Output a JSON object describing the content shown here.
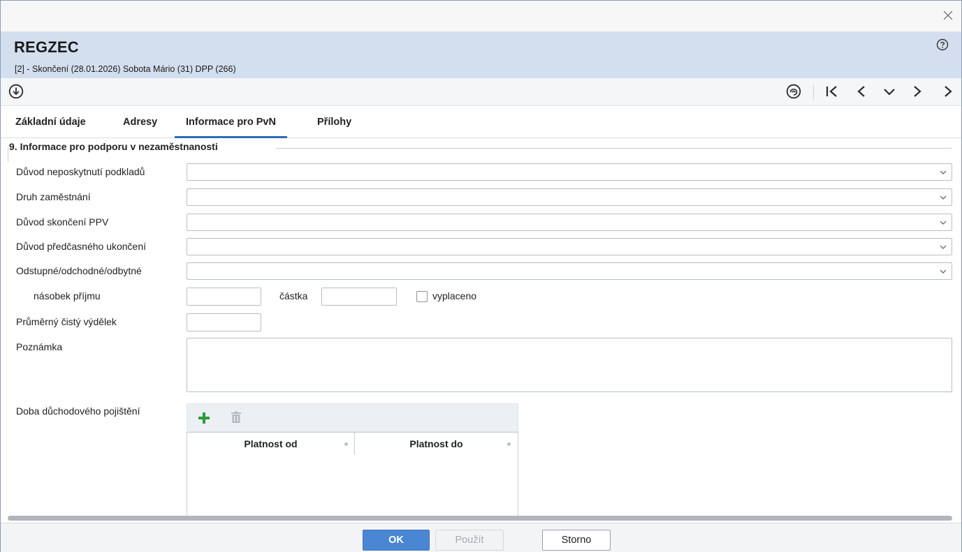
{
  "window": {
    "close_label": "×"
  },
  "header": {
    "title": "REGZEC",
    "subtitle": "[2] - Skončení (28.01.2026) Sobota Mário (31) DPP (266)"
  },
  "toolbar": {
    "icons": [
      "download-circle-icon",
      "fingerprint-icon",
      "first-record-icon",
      "previous-record-icon",
      "dropdown-record-icon",
      "next-record-icon",
      "last-record-icon"
    ]
  },
  "tabs": [
    {
      "label": "Základní údaje",
      "active": false
    },
    {
      "label": "Adresy",
      "active": false
    },
    {
      "label": "Informace pro PvN",
      "active": true
    },
    {
      "label": "Přílohy",
      "active": false
    }
  ],
  "section": {
    "title": "9. Informace pro podporu v nezaměstnanosti"
  },
  "form": {
    "duvod_neposkytnuti": {
      "label": "Důvod neposkytnutí podkladů",
      "value": ""
    },
    "druh_zamestnani": {
      "label": "Druh zaměstnání",
      "value": ""
    },
    "duvod_skonceni": {
      "label": "Důvod skončení PPV",
      "value": ""
    },
    "duvod_predcasneho": {
      "label": "Důvod předčasného ukončení",
      "value": ""
    },
    "odstupne": {
      "label": "Odstupné/odchodné/odbytné",
      "value": ""
    },
    "nasobek": {
      "label": "násobek příjmu",
      "value": ""
    },
    "castka": {
      "label": "částka",
      "value": ""
    },
    "vyplaceno": {
      "label": "vyplaceno",
      "checked": false
    },
    "prumerny_vydelek": {
      "label": "Průměrný čistý výdělek",
      "value": ""
    },
    "poznamka": {
      "label": "Poznámka",
      "value": ""
    },
    "doba_pojisteni": {
      "label": "Doba důchodového pojištění",
      "columns": [
        "Platnost od",
        "Platnost do"
      ],
      "rows": []
    }
  },
  "footer": {
    "ok_label": "OK",
    "pouzit_label": "Použít",
    "storno_label": "Storno"
  },
  "colors": {
    "header_bg": "#d3dfef",
    "accent": "#2f6bb8",
    "ok_button": "#4a86d3",
    "add_green": "#2e9a3a"
  }
}
